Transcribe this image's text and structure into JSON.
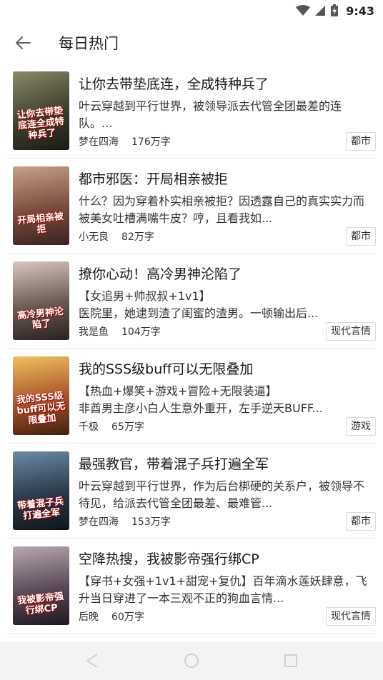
{
  "status": {
    "time": "9:43"
  },
  "header": {
    "title": "每日热门"
  },
  "books": [
    {
      "title": "让你去带垫底连，全成特种兵了",
      "desc": "叶云穿越到平行世界，被领导派去代管全团最差的连队。...",
      "author": "梦在四海",
      "words": "176万字",
      "tag": "都市",
      "cover_text": "让你去带垫底连全成特种兵了",
      "cover_color": "#5a5a4a"
    },
    {
      "title": "都市邪医：开局相亲被拒",
      "desc": "什么？因为穿着朴实相亲被拒？因透露自己的真实实力而被美女吐槽满嘴牛皮？哼，且看我如...",
      "author": "小无良",
      "words": "82万字",
      "tag": "都市",
      "cover_text": "开局相亲被拒",
      "cover_color": "#7a4b3c"
    },
    {
      "title": "撩你心动！高冷男神沦陷了",
      "desc": "【女追男+帅叔叔+1v1】\n医院里，她逮到渣了闺蜜的渣男。一顿输出后...",
      "author": "我是鱼",
      "words": "104万字",
      "tag": "现代言情",
      "cover_text": "高冷男神沦陷了",
      "cover_color": "#6b5a52"
    },
    {
      "title": "我的SSS级buff可以无限叠加",
      "desc": "【热血+爆笑+游戏+冒险+无限装逼】\n非酋男主彦小白人生意外重开，左手逆天BUFF...",
      "author": "千极",
      "words": "65万字",
      "tag": "游戏",
      "cover_text": "我的SSS级buff可以无限叠加",
      "cover_color": "#a9542a"
    },
    {
      "title": "最强教官，带着混子兵打遍全军",
      "desc": "叶云穿越到平行世界，作为后台梆硬的关系户，被领导不待见，给派去代管全团最差、最难管...",
      "author": "梦在四海",
      "words": "153万字",
      "tag": "都市",
      "cover_text": "带着混子兵打遍全军",
      "cover_color": "#2c3a4a"
    },
    {
      "title": "空降热搜，我被影帝强行绑CP",
      "desc": "【穿书+女强+1v1+甜宠+复仇】百年滴水莲妖肆意，飞升当日穿进了一本三观不正的狗血言情...",
      "author": "后晚",
      "words": "60万字",
      "tag": "现代言情",
      "cover_text": "我被影帝强行绑CP",
      "cover_color": "#5a4a58"
    }
  ]
}
